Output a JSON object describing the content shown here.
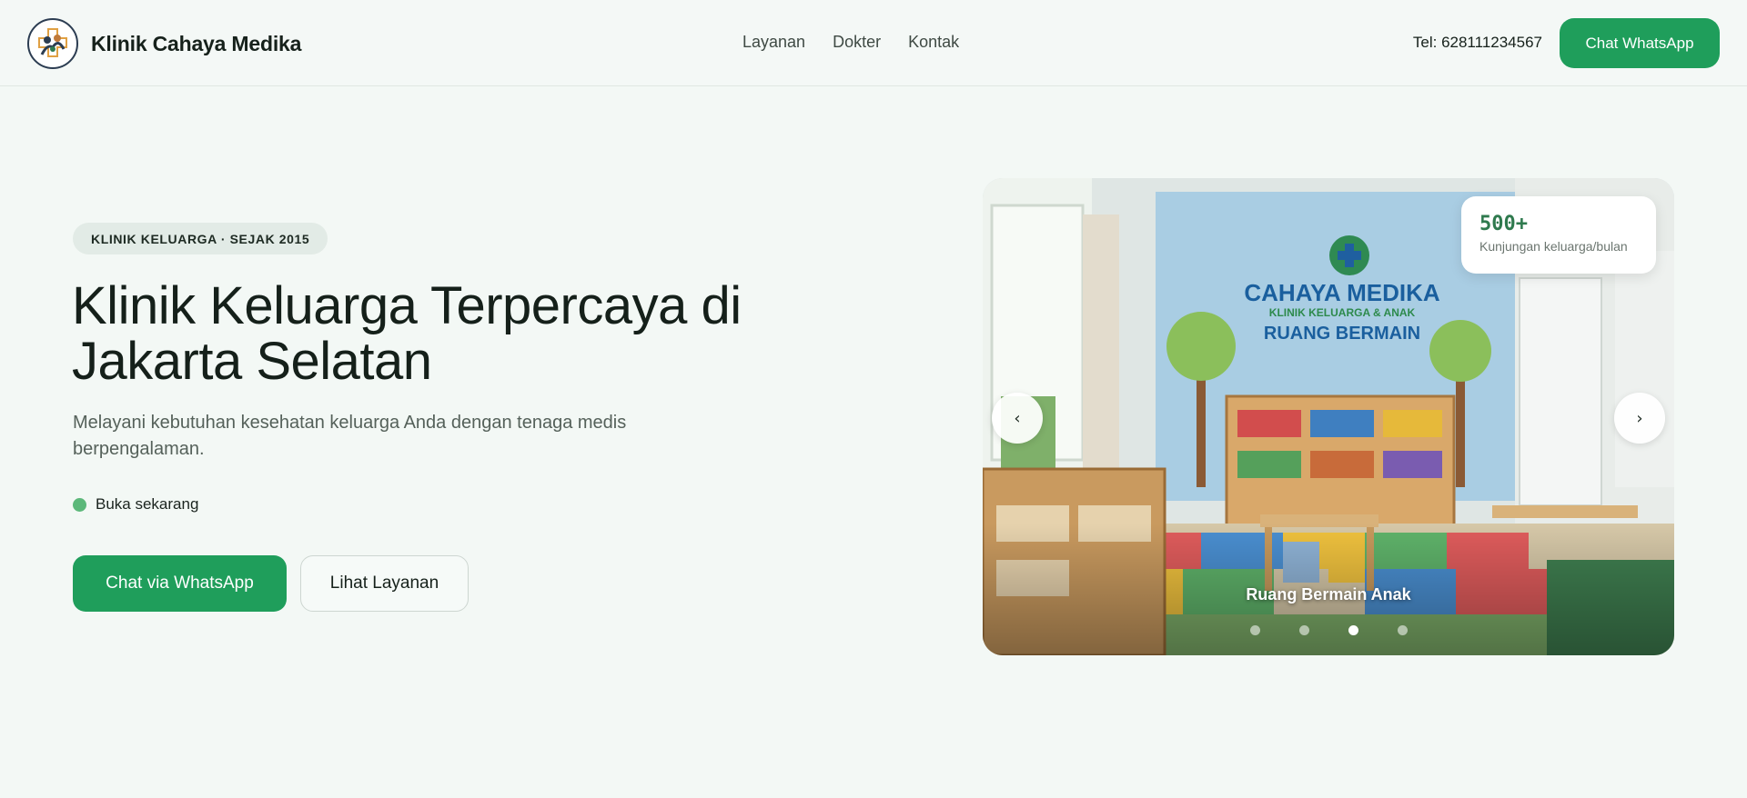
{
  "header": {
    "brand_name": "Klinik Cahaya Medika",
    "nav": [
      {
        "label": "Layanan"
      },
      {
        "label": "Dokter"
      },
      {
        "label": "Kontak"
      }
    ],
    "phone": "Tel: 628111234567",
    "cta_label": "Chat WhatsApp"
  },
  "hero": {
    "badge": "KLINIK KELUARGA · SEJAK 2015",
    "title": "Klinik Keluarga Terpercaya di Jakarta Selatan",
    "subtitle": "Melayani kebutuhan kesehatan keluarga Anda dengan tenaga medis berpengalaman.",
    "status": "Buka sekarang",
    "primary_button": "Chat via WhatsApp",
    "secondary_button": "Lihat Layanan"
  },
  "carousel": {
    "stat_value": "500+",
    "stat_label": "Kunjungan keluarga/bulan",
    "prev_icon": "‹",
    "next_icon": "›",
    "caption": "Ruang Bermain Anak",
    "slide_count": 4,
    "active_slide": 3,
    "image_sign": {
      "name": "CAHAYA MEDIKA",
      "tagline": "KLINIK KELUARGA & ANAK",
      "room": "RUANG BERMAIN"
    }
  },
  "colors": {
    "accent": "#1f9e5b",
    "background": "#f3f8f5",
    "status_dot": "#5cb87a"
  }
}
